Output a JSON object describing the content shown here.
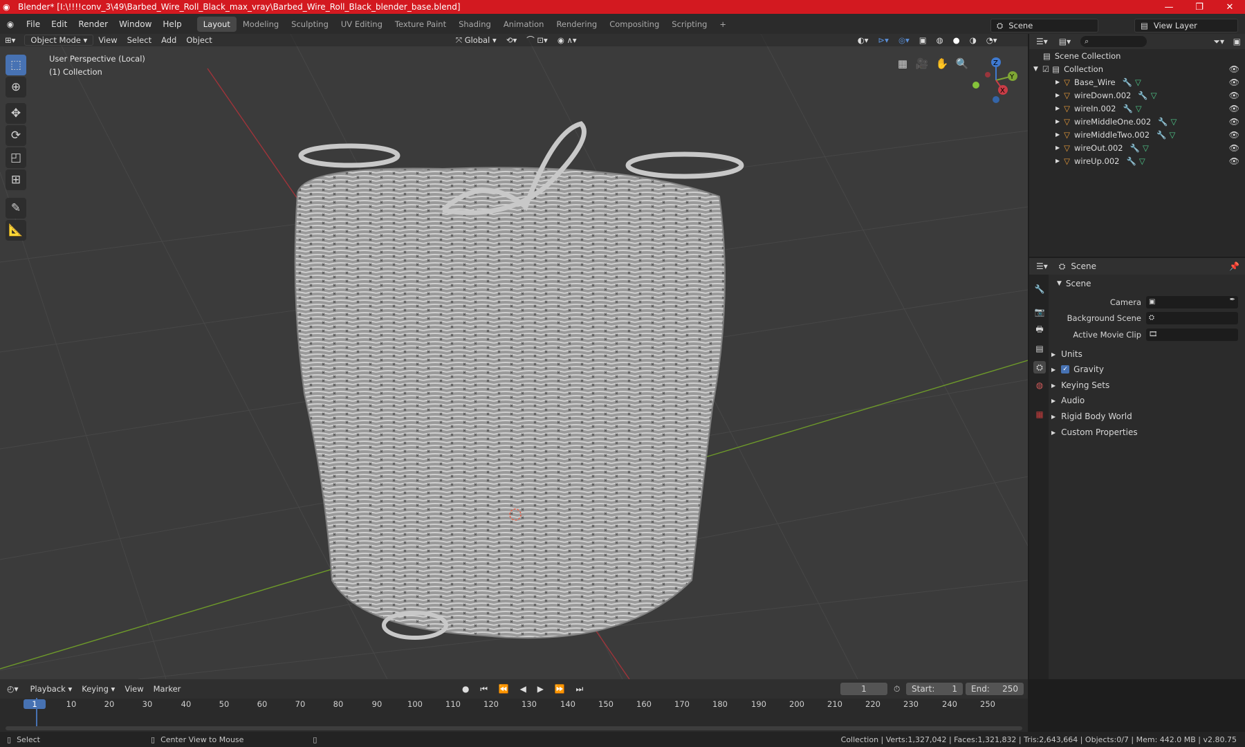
{
  "window": {
    "title": "Blender* [I:\\!!!!conv_3\\49\\Barbed_Wire_Roll_Black_max_vray\\Barbed_Wire_Roll_Black_blender_base.blend]",
    "controls": {
      "minimize": "—",
      "maximize": "❐",
      "close": "✕"
    }
  },
  "menu": {
    "items": [
      "File",
      "Edit",
      "Render",
      "Window",
      "Help"
    ],
    "workspaces": [
      "Layout",
      "Modeling",
      "Sculpting",
      "UV Editing",
      "Texture Paint",
      "Shading",
      "Animation",
      "Rendering",
      "Compositing",
      "Scripting"
    ],
    "active_workspace": "Layout",
    "add_tab": "+",
    "scene_label": "Scene",
    "view_layer_label": "View Layer"
  },
  "viewport_header": {
    "mode": "Object Mode",
    "menus": [
      "View",
      "Select",
      "Add",
      "Object"
    ],
    "orientation": "Global"
  },
  "viewport": {
    "perspective": "User Perspective (Local)",
    "collection": "(1) Collection",
    "gizmo": {
      "x": "X",
      "y": "Y",
      "z": "Z"
    },
    "colors": {
      "x_axis": "#a0343a",
      "y_axis": "#6e9a2a",
      "background": "#3b3b3b",
      "wire": "#b9b9b9"
    }
  },
  "tools": [
    "select-box",
    "cursor",
    "move",
    "rotate",
    "scale",
    "transform",
    "annotate",
    "measure"
  ],
  "outliner": {
    "root": "Scene Collection",
    "collection": "Collection",
    "objects": [
      "Base_Wire",
      "wireDown.002",
      "wireIn.002",
      "wireMiddleOne.002",
      "wireMiddleTwo.002",
      "wireOut.002",
      "wireUp.002"
    ]
  },
  "properties": {
    "header": "Scene",
    "panel": "Scene",
    "fields": [
      {
        "label": "Camera"
      },
      {
        "label": "Background Scene"
      },
      {
        "label": "Active Movie Clip"
      }
    ],
    "sections": [
      "Units",
      "Gravity",
      "Keying Sets",
      "Audio",
      "Rigid Body World",
      "Custom Properties"
    ],
    "gravity_checked": true
  },
  "timeline": {
    "menus": [
      "Playback",
      "Keying",
      "View",
      "Marker"
    ],
    "current_frame": "1",
    "start_label": "Start:",
    "start": "1",
    "end_label": "End:",
    "end": "250",
    "ruler": [
      "1",
      "10",
      "20",
      "30",
      "40",
      "50",
      "60",
      "70",
      "80",
      "90",
      "100",
      "110",
      "120",
      "130",
      "140",
      "150",
      "160",
      "170",
      "180",
      "190",
      "200",
      "210",
      "220",
      "230",
      "240",
      "250"
    ]
  },
  "statusbar": {
    "select": "Select",
    "center": "Center View to Mouse",
    "stats": "Collection | Verts:1,327,042 | Faces:1,321,832 | Tris:2,643,664 | Objects:0/7 | Mem: 442.0 MB | v2.80.75"
  }
}
